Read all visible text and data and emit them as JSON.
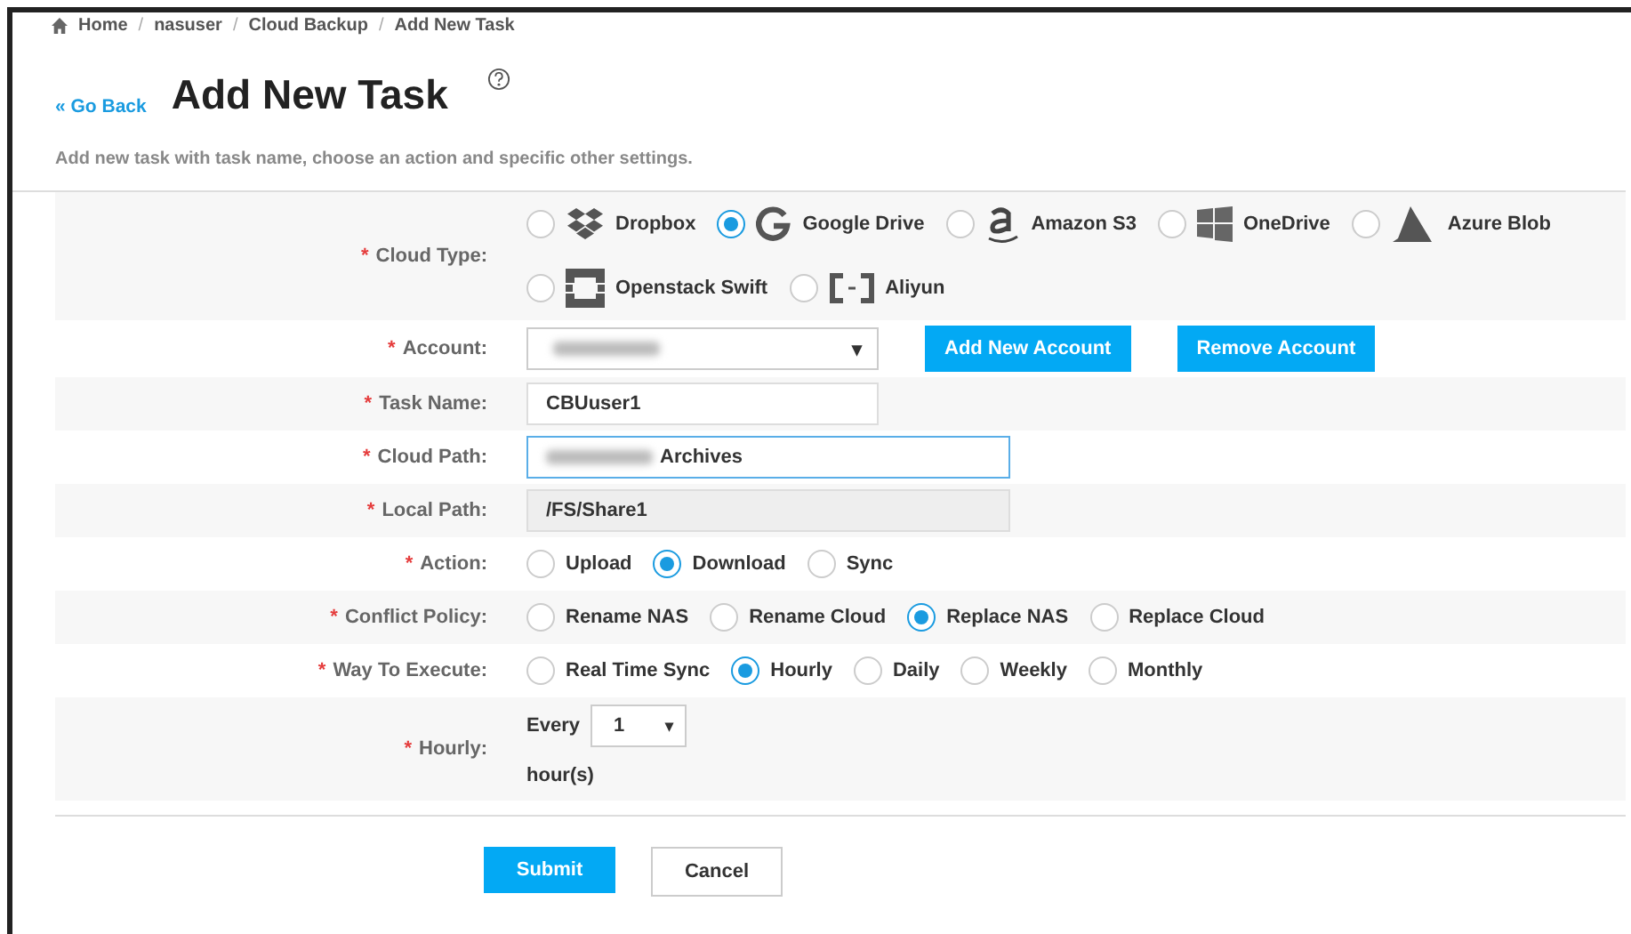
{
  "breadcrumb": [
    "Home",
    "nasuser",
    "Cloud Backup",
    "Add New Task"
  ],
  "breadcrumb_separator": "/",
  "back_link": "« Go Back",
  "title": "Add New Task",
  "description": "Add new task with task name, choose an action and specific other settings.",
  "rows": [
    {
      "kind": "radios",
      "mark": "*",
      "label": "Cloud Type:",
      "options": [
        {
          "label": "Dropbox",
          "selected": false
        },
        {
          "label": "Google Drive",
          "selected": true
        },
        {
          "label": "Amazon S3",
          "selected": false
        },
        {
          "label": "OneDrive",
          "selected": false
        },
        {
          "label": "Azure Blob",
          "selected": false
        },
        {
          "label": "Openstack Swift",
          "selected": false
        },
        {
          "label": "Aliyun",
          "selected": false
        }
      ]
    },
    {
      "kind": "account",
      "mark": "*",
      "label": "Account:",
      "caret": "▾",
      "buttons": [
        "Add New Account",
        "Remove Account"
      ]
    },
    {
      "kind": "text",
      "mark": "*",
      "label": "Task Name:",
      "value": "CBUuser1",
      "focused": false
    },
    {
      "kind": "blurtext",
      "mark": "*",
      "label": "Cloud Path:",
      "value": "Archives",
      "focused": true
    },
    {
      "kind": "readonly",
      "mark": "*",
      "label": "Local Path:",
      "value": "/FS/Share1"
    },
    {
      "kind": "radios",
      "mark": "*",
      "label": "Action:",
      "options": [
        {
          "label": "Upload",
          "selected": false
        },
        {
          "label": "Download",
          "selected": true
        },
        {
          "label": "Sync",
          "selected": false
        }
      ]
    },
    {
      "kind": "radios",
      "mark": "*",
      "label": "Conflict Policy:",
      "options": [
        {
          "label": "Rename NAS",
          "selected": false
        },
        {
          "label": "Rename Cloud",
          "selected": false
        },
        {
          "label": "Replace NAS",
          "selected": true
        },
        {
          "label": "Replace Cloud",
          "selected": false
        }
      ]
    },
    {
      "kind": "radios",
      "mark": "*",
      "label": "Way To Execute:",
      "options": [
        {
          "label": "Real Time Sync",
          "selected": false
        },
        {
          "label": "Hourly",
          "selected": true
        },
        {
          "label": "Daily",
          "selected": false
        },
        {
          "label": "Weekly",
          "selected": false
        },
        {
          "label": "Monthly",
          "selected": false
        }
      ]
    },
    {
      "kind": "hourly",
      "mark": "*",
      "label": "Hourly:",
      "prefix": "Every",
      "value": "1",
      "caret": "▾",
      "suffix": "hour(s)"
    }
  ],
  "submit": "Submit",
  "cancel": "Cancel"
}
